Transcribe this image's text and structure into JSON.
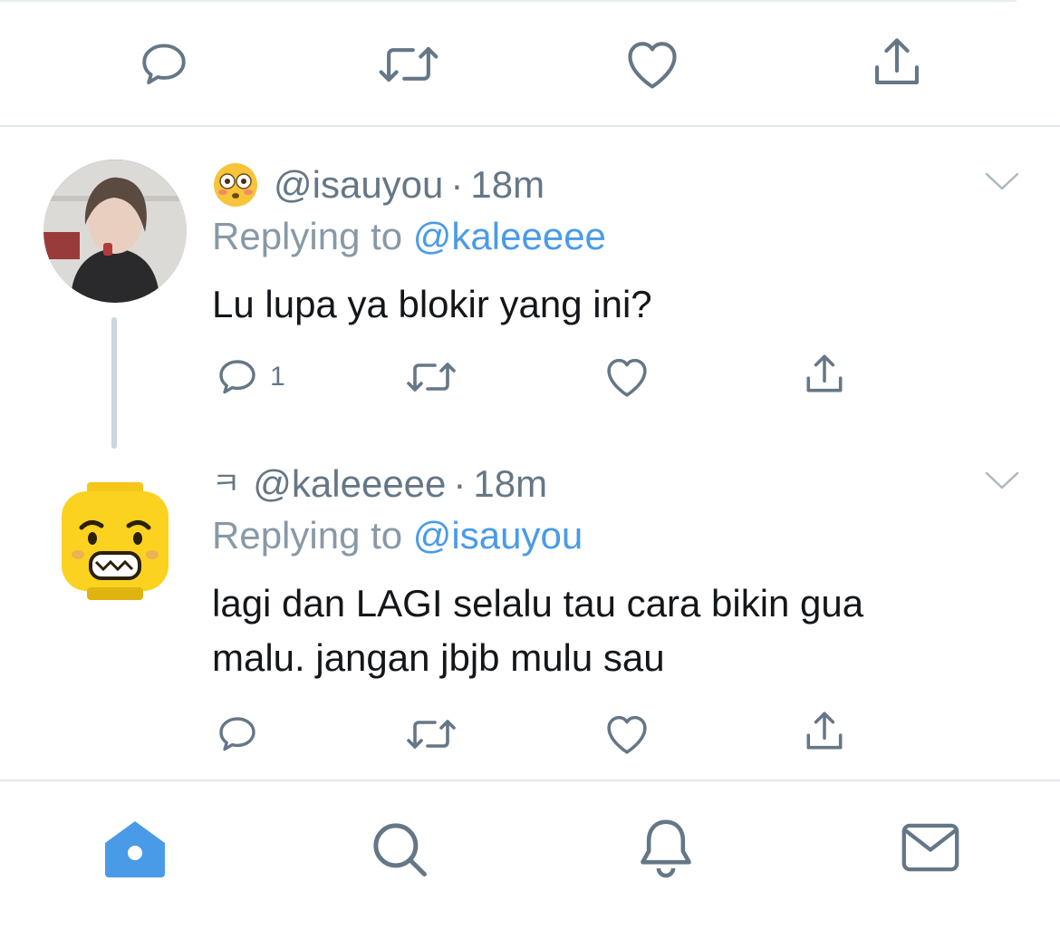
{
  "top_actions": {
    "reply_icon": "comment-icon",
    "retweet_icon": "retweet-icon",
    "like_icon": "heart-icon",
    "share_icon": "share-icon"
  },
  "tweets": [
    {
      "emoji": "😳",
      "handle": "@isauyou",
      "separator": "·",
      "time": "18m",
      "replying_prefix": "Replying to",
      "replying_to": "@kaleeeee",
      "text": "Lu lupa ya blokir yang ini?",
      "reply_count": "1"
    },
    {
      "emoji": "ㅋ",
      "handle": "@kaleeeee",
      "separator": "·",
      "time": "18m",
      "replying_prefix": "Replying to",
      "replying_to": "@isauyou",
      "text_line1": "lagi dan LAGI selalu tau cara bikin gua",
      "text_line2": "malu. jangan jbjb mulu sau"
    }
  ],
  "tabbar": {
    "home_icon": "home-icon",
    "search_icon": "search-icon",
    "notifications_icon": "bell-icon",
    "messages_icon": "mail-icon"
  },
  "colors": {
    "accent": "#4a9be7",
    "icon_gray": "#657786",
    "divider": "#e1e8ed"
  }
}
